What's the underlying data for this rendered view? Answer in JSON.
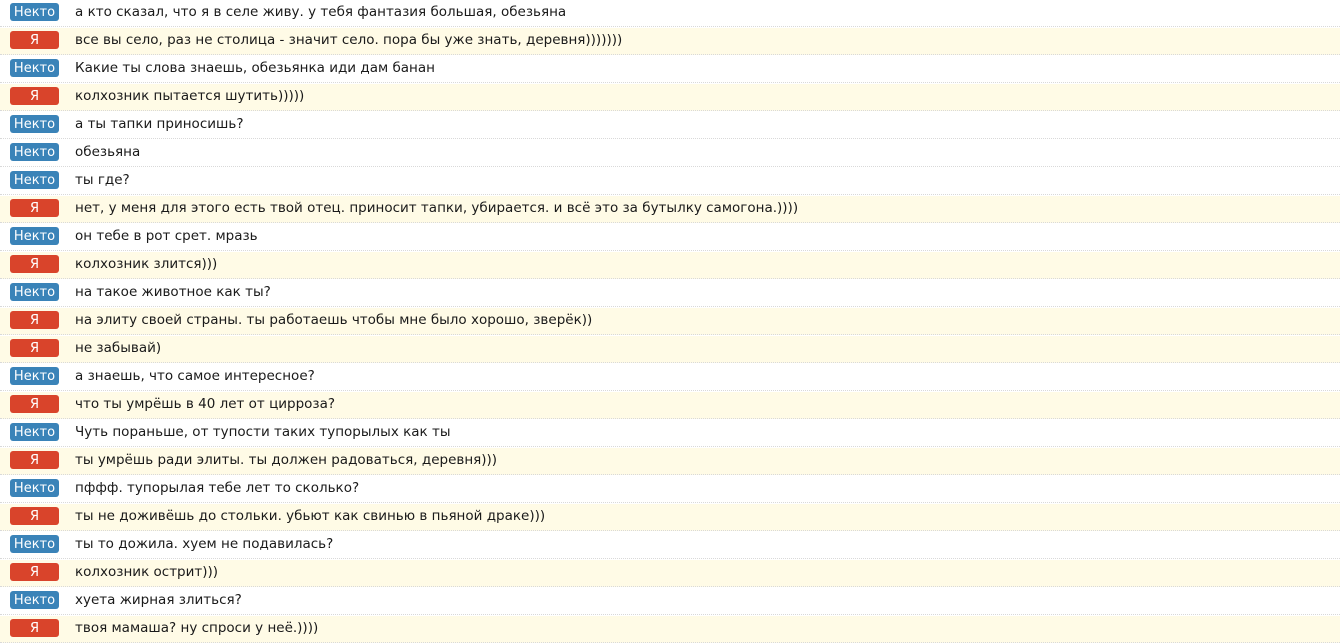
{
  "labels": {
    "stranger": "Некто",
    "me": "Я"
  },
  "colors": {
    "stranger_badge": "#3a83b8",
    "me_badge": "#d9442b",
    "me_row_bg": "#fffbe6"
  },
  "messages": [
    {
      "sender": "Некто",
      "role": "stranger",
      "text": "а кто сказал, что я в селе живу. у тебя фантазия большая, обезьяна"
    },
    {
      "sender": "Я",
      "role": "me",
      "text": "все вы село, раз не столица - значит село. пора бы уже знать, деревня)))))))"
    },
    {
      "sender": "Некто",
      "role": "stranger",
      "text": "Какие ты слова знаешь, обезьянка иди дам банан"
    },
    {
      "sender": "Я",
      "role": "me",
      "text": "колхозник пытается шутить)))))"
    },
    {
      "sender": "Некто",
      "role": "stranger",
      "text": "а ты тапки приносишь?"
    },
    {
      "sender": "Некто",
      "role": "stranger",
      "text": "обезьяна"
    },
    {
      "sender": "Некто",
      "role": "stranger",
      "text": "ты где?"
    },
    {
      "sender": "Я",
      "role": "me",
      "text": "нет, у меня для этого есть твой отец. приносит тапки, убирается. и всё это за бутылку самогона.))))"
    },
    {
      "sender": "Некто",
      "role": "stranger",
      "text": "он тебе в рот срет. мразь"
    },
    {
      "sender": "Я",
      "role": "me",
      "text": "колхозник злится)))"
    },
    {
      "sender": "Некто",
      "role": "stranger",
      "text": "на такое животное как ты?"
    },
    {
      "sender": "Я",
      "role": "me",
      "text": "на элиту своей страны. ты работаешь чтобы мне было хорошо, зверёк))"
    },
    {
      "sender": "Я",
      "role": "me",
      "text": "не забывай)"
    },
    {
      "sender": "Некто",
      "role": "stranger",
      "text": "а знаешь, что самое интересное?"
    },
    {
      "sender": "Я",
      "role": "me",
      "text": "что ты умрёшь в 40 лет от цирроза?"
    },
    {
      "sender": "Некто",
      "role": "stranger",
      "text": "Чуть пораньше, от тупости таких тупорылых как ты"
    },
    {
      "sender": "Я",
      "role": "me",
      "text": "ты умрёшь ради элиты. ты должен радоваться, деревня)))"
    },
    {
      "sender": "Некто",
      "role": "stranger",
      "text": "пффф. тупорылая тебе лет то сколько?"
    },
    {
      "sender": "Я",
      "role": "me",
      "text": "ты не доживёшь до стольки. убьют как свинью в пьяной драке)))"
    },
    {
      "sender": "Некто",
      "role": "stranger",
      "text": "ты то дожила. хуем не подавилась?"
    },
    {
      "sender": "Я",
      "role": "me",
      "text": "колхозник острит)))"
    },
    {
      "sender": "Некто",
      "role": "stranger",
      "text": "хуета жирная злиться?"
    },
    {
      "sender": "Я",
      "role": "me",
      "text": "твоя мамаша? ну спроси у неё.))))"
    }
  ]
}
